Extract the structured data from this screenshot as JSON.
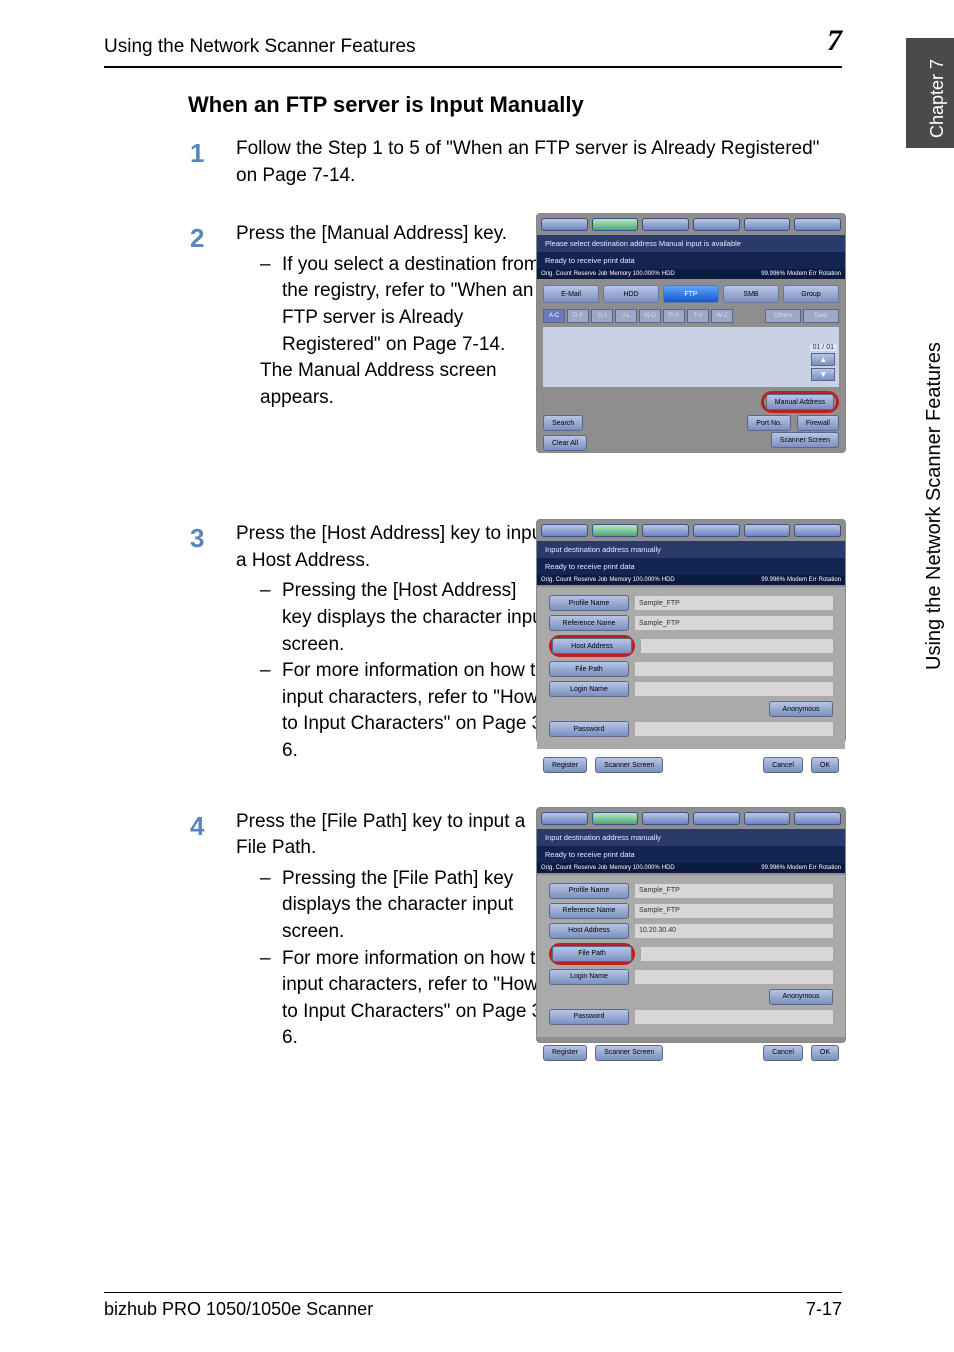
{
  "header": {
    "breadcrumb": "Using the Network Scanner Features",
    "chapter_number_badge": "7"
  },
  "sidebar": {
    "chapter_label": "Chapter 7",
    "feature_label": "Using the Network Scanner Features"
  },
  "section": {
    "title": "When an FTP server is Input Manually"
  },
  "steps": {
    "s1": {
      "num": "1",
      "text": "Follow the Step 1 to 5 of \"When an FTP server is Already Registered\" on Page 7-14."
    },
    "s2": {
      "num": "2",
      "lead": "Press the [Manual Address] key.",
      "sub1": "If you select a destination from the registry, refer to \"When an FTP server is Already Registered\" on Page 7-14.",
      "tail": "The Manual Address screen appears."
    },
    "s3": {
      "num": "3",
      "lead": "Press the [Host Address] key to input a Host Address.",
      "sub1": "Pressing the [Host Address] key displays the character input screen.",
      "sub2": "For more information on how to input characters, refer to \"How to Input Characters\" on Page 3-6."
    },
    "s4": {
      "num": "4",
      "lead": "Press the [File Path] key to input a File Path.",
      "sub1": "Pressing the [File Path] key displays the character input screen.",
      "sub2": "For more information on how to input characters, refer to \"How to Input Characters\" on Page 3-6."
    }
  },
  "screenshots": {
    "common_top": {
      "header1": "Please select destination address\nManual input is available",
      "header2": "Input destination address manually",
      "ready": "Ready to receive print data",
      "status_left": "Orig. Count",
      "status_reserve": "Reserve Job",
      "status_mem": "Memory 100.000%",
      "status_hdd": "HDD",
      "status_pct": "99.996%",
      "status_mod": "Modem Err",
      "status_rot": "Rotation"
    },
    "tabs": {
      "email": "E-Mail",
      "hdd": "HDD",
      "ftp": "FTP",
      "smb": "SMB",
      "group": "Group"
    },
    "alpha": [
      "A-C",
      "D-F",
      "G-I",
      "J-L",
      "M-O",
      "P-S",
      "T-V",
      "W-Z"
    ],
    "alpha_right": {
      "others": "Others",
      "daily": "Daily"
    },
    "pager": {
      "count": "01 / 01",
      "up": "▲",
      "down": "▼"
    },
    "buttons": {
      "manual_address": "Manual Address",
      "search": "Search",
      "port_no": "Port No.",
      "firewall": "Firewall",
      "clear_all": "Clear All",
      "scanner_screen": "Scanner Screen",
      "register": "Register",
      "cancel": "Cancel",
      "ok": "OK",
      "anonymous": "Anonymous"
    },
    "form": {
      "profile_name_lbl": "Profile Name",
      "reference_name_lbl": "Reference Name",
      "host_address_lbl": "Host Address",
      "file_path_lbl": "File Path",
      "login_name_lbl": "Login Name",
      "password_lbl": "Password",
      "profile_name_val": "Sample_FTP",
      "reference_name_val": "Sample_FTP",
      "host_address_val_step4": "10.20.30.40",
      "empty": ""
    }
  },
  "footer": {
    "left": "bizhub PRO 1050/1050e Scanner",
    "right": "7-17"
  }
}
